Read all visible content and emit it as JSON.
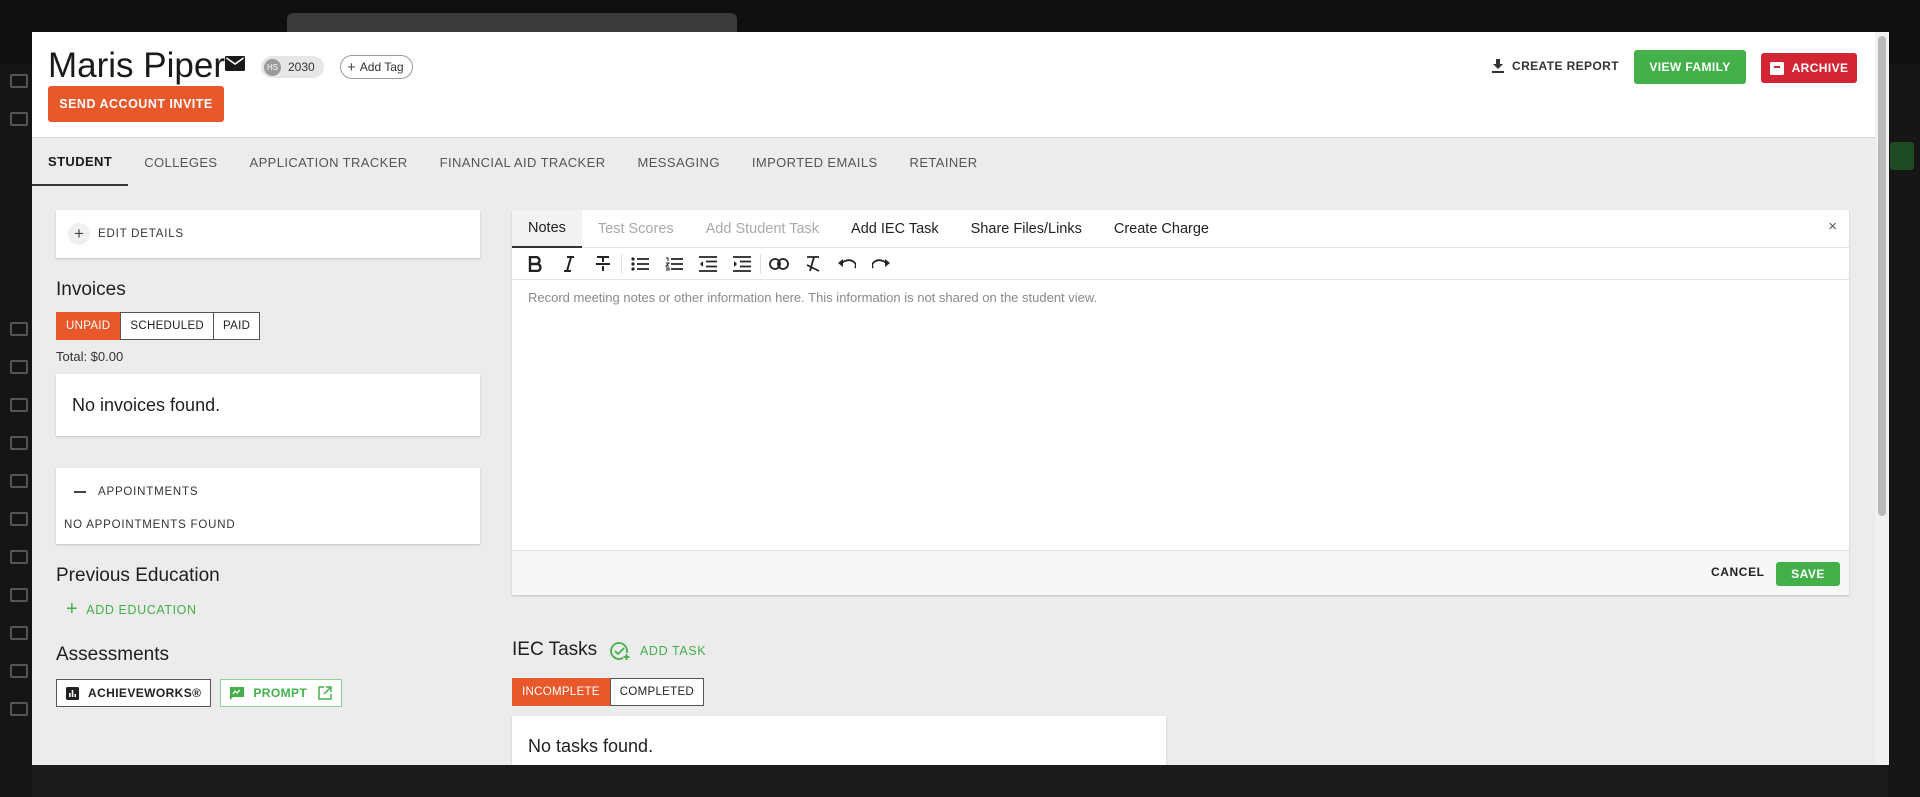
{
  "student": {
    "name": "Maris Piper",
    "hs_badge": "HS",
    "grad_year": "2030",
    "add_tag": "Add Tag",
    "send_invite": "SEND ACCOUNT INVITE"
  },
  "header_actions": {
    "create_report": "CREATE REPORT",
    "view_family": "VIEW FAMILY",
    "archive": "ARCHIVE"
  },
  "tabs": [
    {
      "label": "STUDENT",
      "active": true
    },
    {
      "label": "COLLEGES"
    },
    {
      "label": "APPLICATION TRACKER"
    },
    {
      "label": "FINANCIAL AID TRACKER"
    },
    {
      "label": "MESSAGING"
    },
    {
      "label": "IMPORTED EMAILS"
    },
    {
      "label": "RETAINER"
    }
  ],
  "left": {
    "edit_details": "EDIT DETAILS",
    "invoices": {
      "title": "Invoices",
      "filters": [
        "UNPAID",
        "SCHEDULED",
        "PAID"
      ],
      "active_filter": "UNPAID",
      "total": "Total: $0.00",
      "empty": "No invoices found."
    },
    "appointments": {
      "title": "APPOINTMENTS",
      "empty": "NO APPOINTMENTS FOUND"
    },
    "previous_education": {
      "title": "Previous Education",
      "add": "ADD EDUCATION"
    },
    "assessments": {
      "title": "Assessments",
      "achieveworks": "ACHIEVEWORKS®",
      "prompt": "PROMPT"
    }
  },
  "notes_panel": {
    "tabs": [
      {
        "label": "Notes",
        "active": true
      },
      {
        "label": "Test Scores",
        "disabled": true
      },
      {
        "label": "Add Student Task",
        "disabled": true
      },
      {
        "label": "Add IEC Task"
      },
      {
        "label": "Share Files/Links"
      },
      {
        "label": "Create Charge"
      }
    ],
    "close": "×",
    "toolbar": [
      "bold-icon",
      "italic-icon",
      "strikethrough-icon",
      "bullet-list-icon",
      "numbered-list-icon",
      "outdent-icon",
      "indent-icon",
      "link-icon",
      "clear-format-icon",
      "undo-icon",
      "redo-icon"
    ],
    "placeholder": "Record meeting notes or other information here. This information is not shared on the student view.",
    "cancel": "CANCEL",
    "save": "SAVE"
  },
  "iec_tasks": {
    "title": "IEC Tasks",
    "add": "ADD TASK",
    "filters": [
      "INCOMPLETE",
      "COMPLETED"
    ],
    "active_filter": "INCOMPLETE",
    "empty": "No tasks found."
  },
  "colors": {
    "orange": "#e9582a",
    "green": "#43b04a",
    "red": "#d32434"
  }
}
